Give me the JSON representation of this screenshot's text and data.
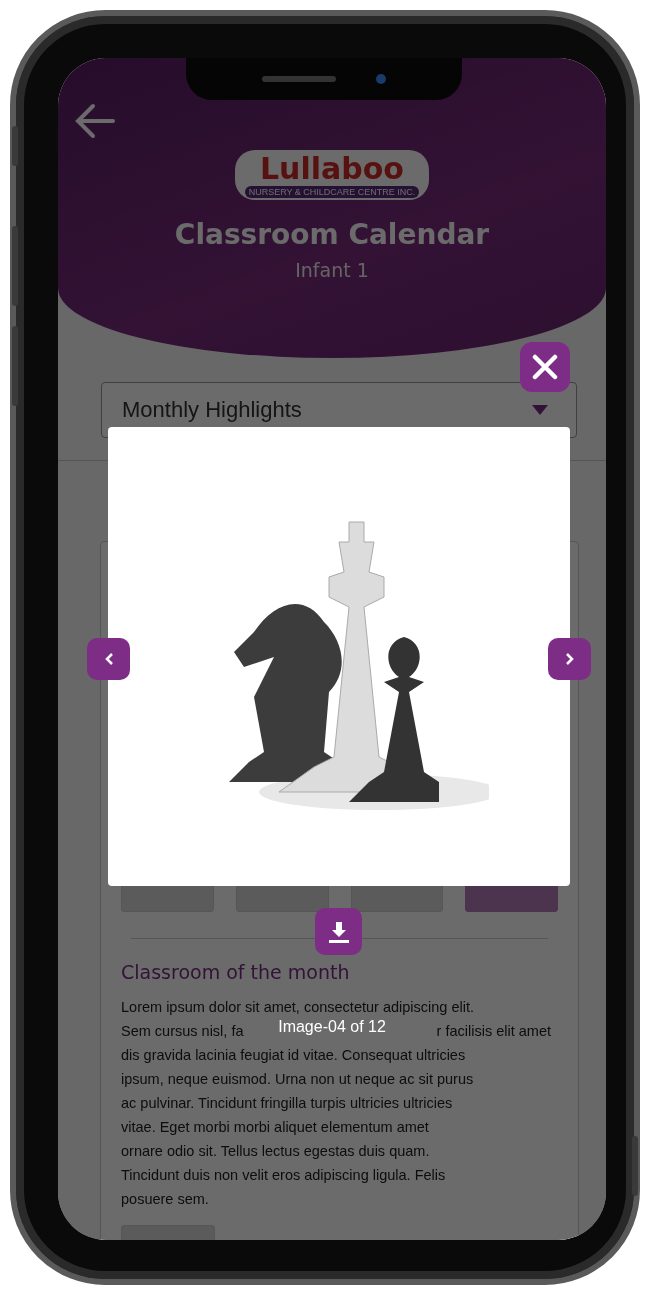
{
  "header": {
    "logo": {
      "name": "Lullaboo",
      "tagline": "NURSERY & CHILDCARE CENTRE INC."
    },
    "title": "Classroom Calendar",
    "subtitle": "Infant 1"
  },
  "dropdown": {
    "value": "Monthly Highlights"
  },
  "section": {
    "thumbnails": [
      {
        "kind": "photo"
      },
      {
        "kind": "photo"
      },
      {
        "kind": "photo"
      },
      {
        "kind": "more"
      }
    ],
    "heading": "Classroom of the month",
    "paragraph_lines": [
      [
        "Lorem ipsum dolor sit amet, consectetur adipiscing elit."
      ],
      [
        "Sem cursus nisl, fa",
        "r facilisis elit amet"
      ],
      [
        "dis gravida lacinia feugiat id vitae. Consequat ultricies"
      ],
      [
        "ipsum, neque euismod. Urna non ut neque ac sit purus"
      ],
      [
        "ac pulvinar. Tincidunt fringilla turpis ultricies ultricies"
      ],
      [
        "vitae. Eget morbi morbi aliquet elementum amet"
      ],
      [
        "ornare odio sit. Tellus lectus egestas duis quam."
      ],
      [
        "Tincidunt duis non velit eros adipiscing ligula. Felis"
      ],
      [
        "posuere sem."
      ]
    ],
    "bottom_thumbnails": [
      {
        "kind": "photo"
      }
    ]
  },
  "viewer": {
    "caption": "Image-04 of 12"
  }
}
